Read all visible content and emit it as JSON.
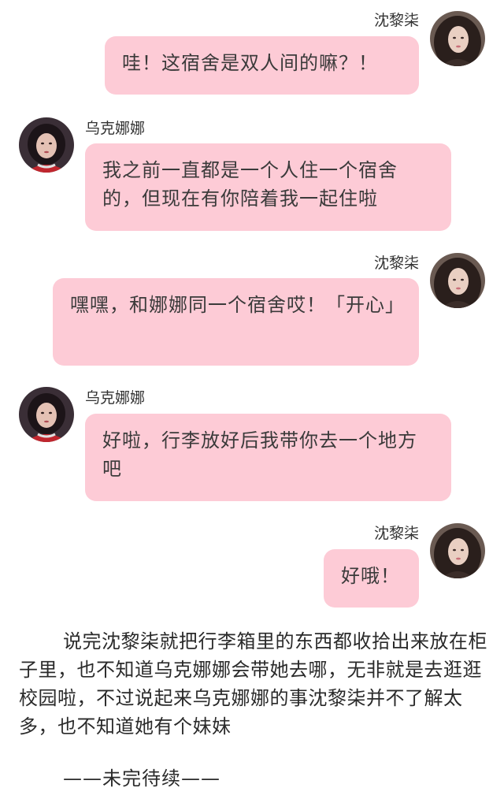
{
  "messages": [
    {
      "side": "right",
      "sender": "沈黎柒",
      "text": "哇！这宿舍是双人间的嘛？！",
      "avatar": "avatar-shen"
    },
    {
      "side": "left",
      "sender": "乌克娜娜",
      "text": "我之前一直都是一个人住一个宿舍的，但现在有你陪着我一起住啦",
      "avatar": "avatar-wu"
    },
    {
      "side": "right",
      "sender": "沈黎柒",
      "text": "嘿嘿，和娜娜同一个宿舍哎！「开心」",
      "avatar": "avatar-shen"
    },
    {
      "side": "left",
      "sender": "乌克娜娜",
      "text": "好啦，行李放好后我带你去一个地方吧",
      "avatar": "avatar-wu"
    },
    {
      "side": "right",
      "sender": "沈黎柒",
      "text": "好哦！",
      "avatar": "avatar-shen"
    }
  ],
  "narration": "说完沈黎柒就把行李箱里的东西都收拾出来放在柜子里，也不知道乌克娜娜会带她去哪，无非就是去逛逛校园啦，不过说起来乌克娜娜的事沈黎柒并不了解太多，也不知道她有个妹妹",
  "ending": "——未完待续——",
  "colors": {
    "bubble": "#fdcbd6",
    "background": "#ffffff"
  }
}
